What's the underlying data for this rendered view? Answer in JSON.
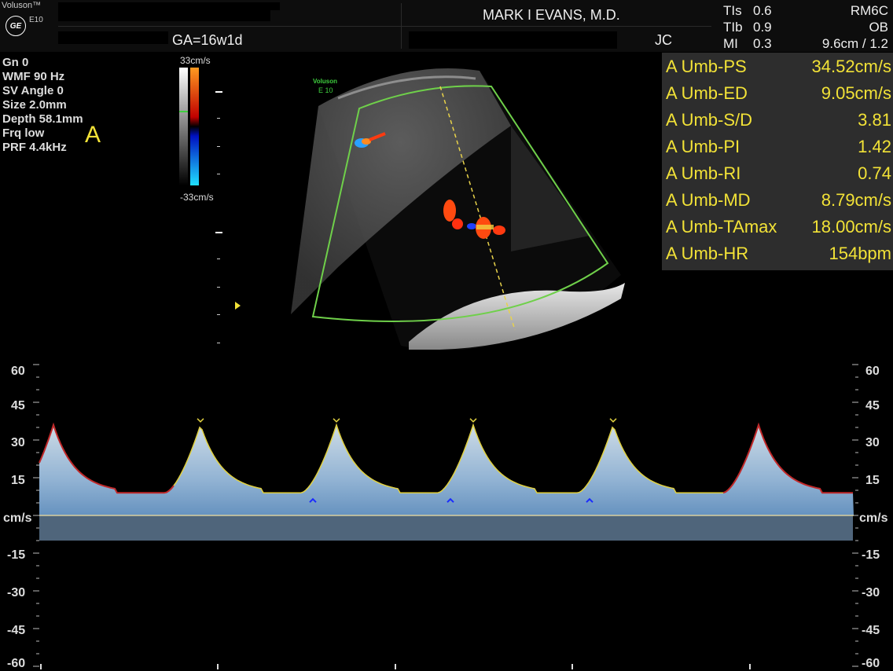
{
  "header": {
    "brand": "Voluson™",
    "model": "E10",
    "logo": "GE",
    "ga": "GA=16w1d",
    "doctor": "MARK I EVANS, M.D.",
    "initials": "JC",
    "tis": "TIs",
    "tis_val": "0.6",
    "tib": "TIb",
    "tib_val": "0.9",
    "mi": "MI",
    "mi_val": "0.3",
    "probe": "RM6C",
    "preset": "OB",
    "depth_zoom": "9.6cm / 1.2"
  },
  "params": [
    "Gn  0",
    "WMF 90 Hz",
    "SV Angle  0",
    "Size  2.0mm",
    "Depth 58.1mm",
    "Frq low",
    "PRF  4.4kHz"
  ],
  "mode_label": "A",
  "colorbar": {
    "max": "33cm/s",
    "min": "-33cm/s"
  },
  "image_watermark": {
    "line1": "Voluson",
    "line2": "E 10"
  },
  "measurements": [
    {
      "label": "A Umb-PS",
      "value": "34.52cm/s"
    },
    {
      "label": "A Umb-ED",
      "value": "9.05cm/s"
    },
    {
      "label": "A Umb-S/D",
      "value": "3.81"
    },
    {
      "label": "A Umb-PI",
      "value": "1.42"
    },
    {
      "label": "A Umb-RI",
      "value": "0.74"
    },
    {
      "label": "A Umb-MD",
      "value": "8.79cm/s"
    },
    {
      "label": "A Umb-TAmax",
      "value": "18.00cm/s"
    },
    {
      "label": "A Umb-HR",
      "value": "154bpm"
    }
  ],
  "spectral_axis": {
    "unit": "cm/s",
    "ticks": [
      "60",
      "45",
      "30",
      "15",
      "-15",
      "-30",
      "-45",
      "-60"
    ]
  },
  "colors": {
    "measurement_text": "#f2e237",
    "sector_outline": "#6fd04a",
    "envelope": "#e0d040",
    "envelope_red": "#c0282a",
    "spectrum": "#bcd8f0"
  }
}
